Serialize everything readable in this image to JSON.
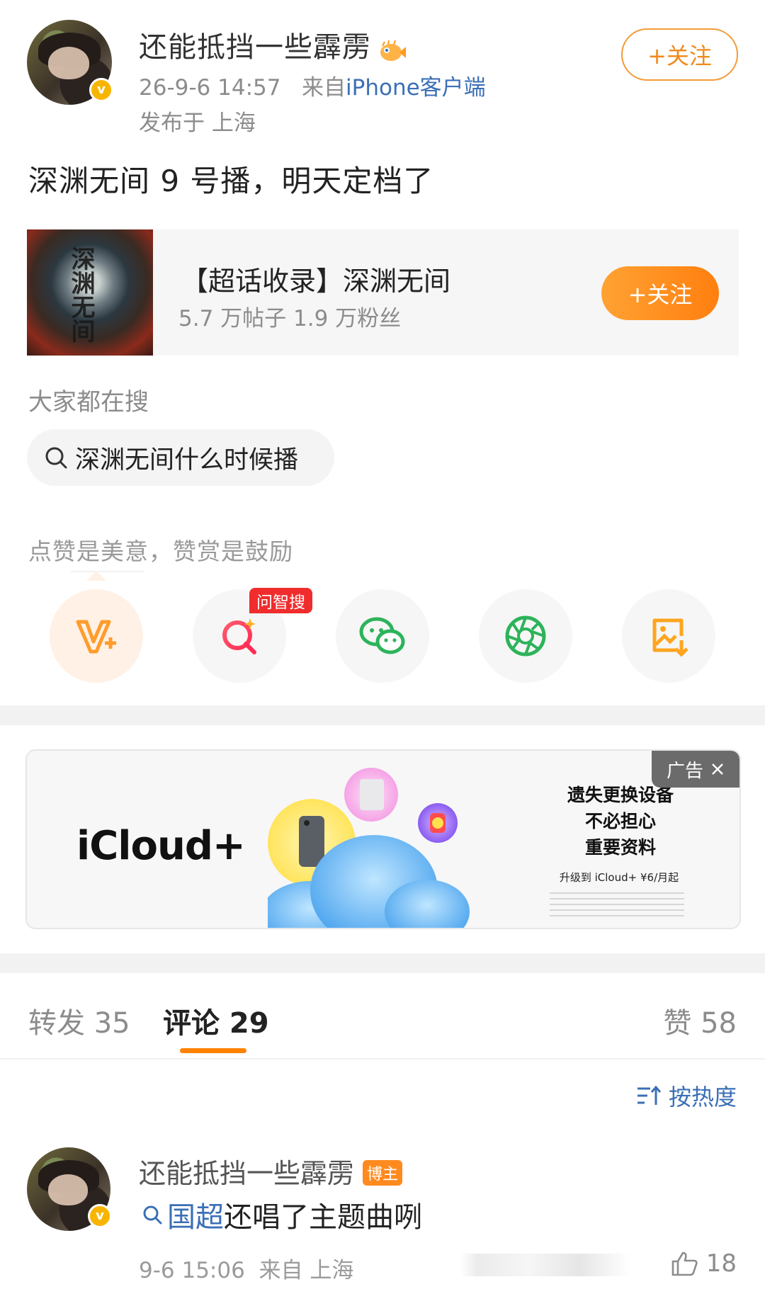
{
  "post": {
    "author": "还能抵挡一些霹雳",
    "time": "26-9-6 14:57",
    "source_prefix": "来自",
    "source": "iPhone客户端",
    "location": "发布于 上海",
    "follow_label": "+关注",
    "text": "深渊无间 9 号播，明天定档了"
  },
  "topic_card": {
    "cover_text": "深渊无间",
    "title": "【超话收录】深渊无间",
    "subtitle": "5.7 万帖子 1.9 万粉丝",
    "follow_label": "+关注"
  },
  "search": {
    "heading": "大家都在搜",
    "query": "深渊无间什么时候播"
  },
  "reward": {
    "heading": "点赞是美意，赞赏是鼓励",
    "ai_badge": "问智搜"
  },
  "ad": {
    "brand": "iCloud+",
    "tag": "广告",
    "copy_line1": "遗失更换设备",
    "copy_line2": "不必担心",
    "copy_line3": "重要资料",
    "small": "升级到 iCloud+ ¥6/月起"
  },
  "tabs": {
    "repost": "转发 35",
    "comment": "评论 29",
    "like": "赞 58"
  },
  "sort_label": "按热度",
  "comment": {
    "author": "还能抵挡一些霹雳",
    "op_badge": "博主",
    "topic_link": "国超",
    "text": "还唱了主题曲咧",
    "time": "9-6 15:06",
    "location": "来自 上海",
    "likes": "18"
  },
  "colors": {
    "accent": "#ff8200",
    "link": "#3b6fb6",
    "verified": "#f7b500"
  }
}
